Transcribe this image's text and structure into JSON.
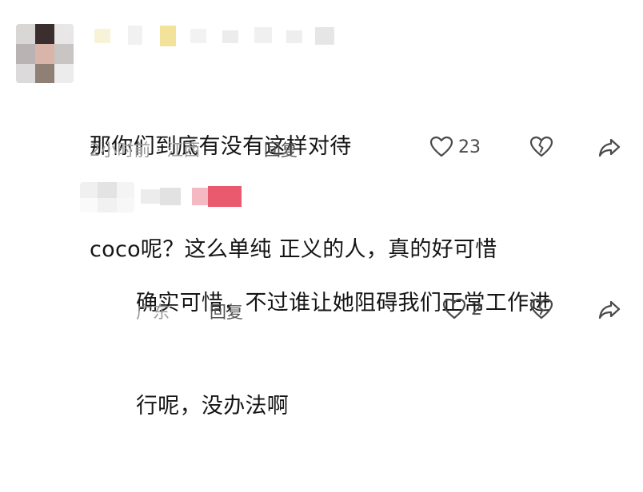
{
  "comments": [
    {
      "text_line1": "那你们到底有没有这样对待",
      "text_line2": "coco呢？这么单纯 正义的人，真的好可惜",
      "meta": "2小时前 · 江西",
      "reply_label": "回复",
      "like_count": "23",
      "icons": {
        "like": "heart-outline-icon",
        "dislike": "broken-heart-icon",
        "share": "share-arrow-icon"
      }
    },
    {
      "text_line1": "确实可惜，不过谁让她阻碍我们正常工作进",
      "text_line2": "行呢，没办法啊",
      "meta": "广东",
      "reply_label": "回复",
      "like_count": "2",
      "icons": {
        "like": "heart-outline-icon",
        "dislike": "broken-heart-icon",
        "share": "share-arrow-icon"
      }
    }
  ]
}
